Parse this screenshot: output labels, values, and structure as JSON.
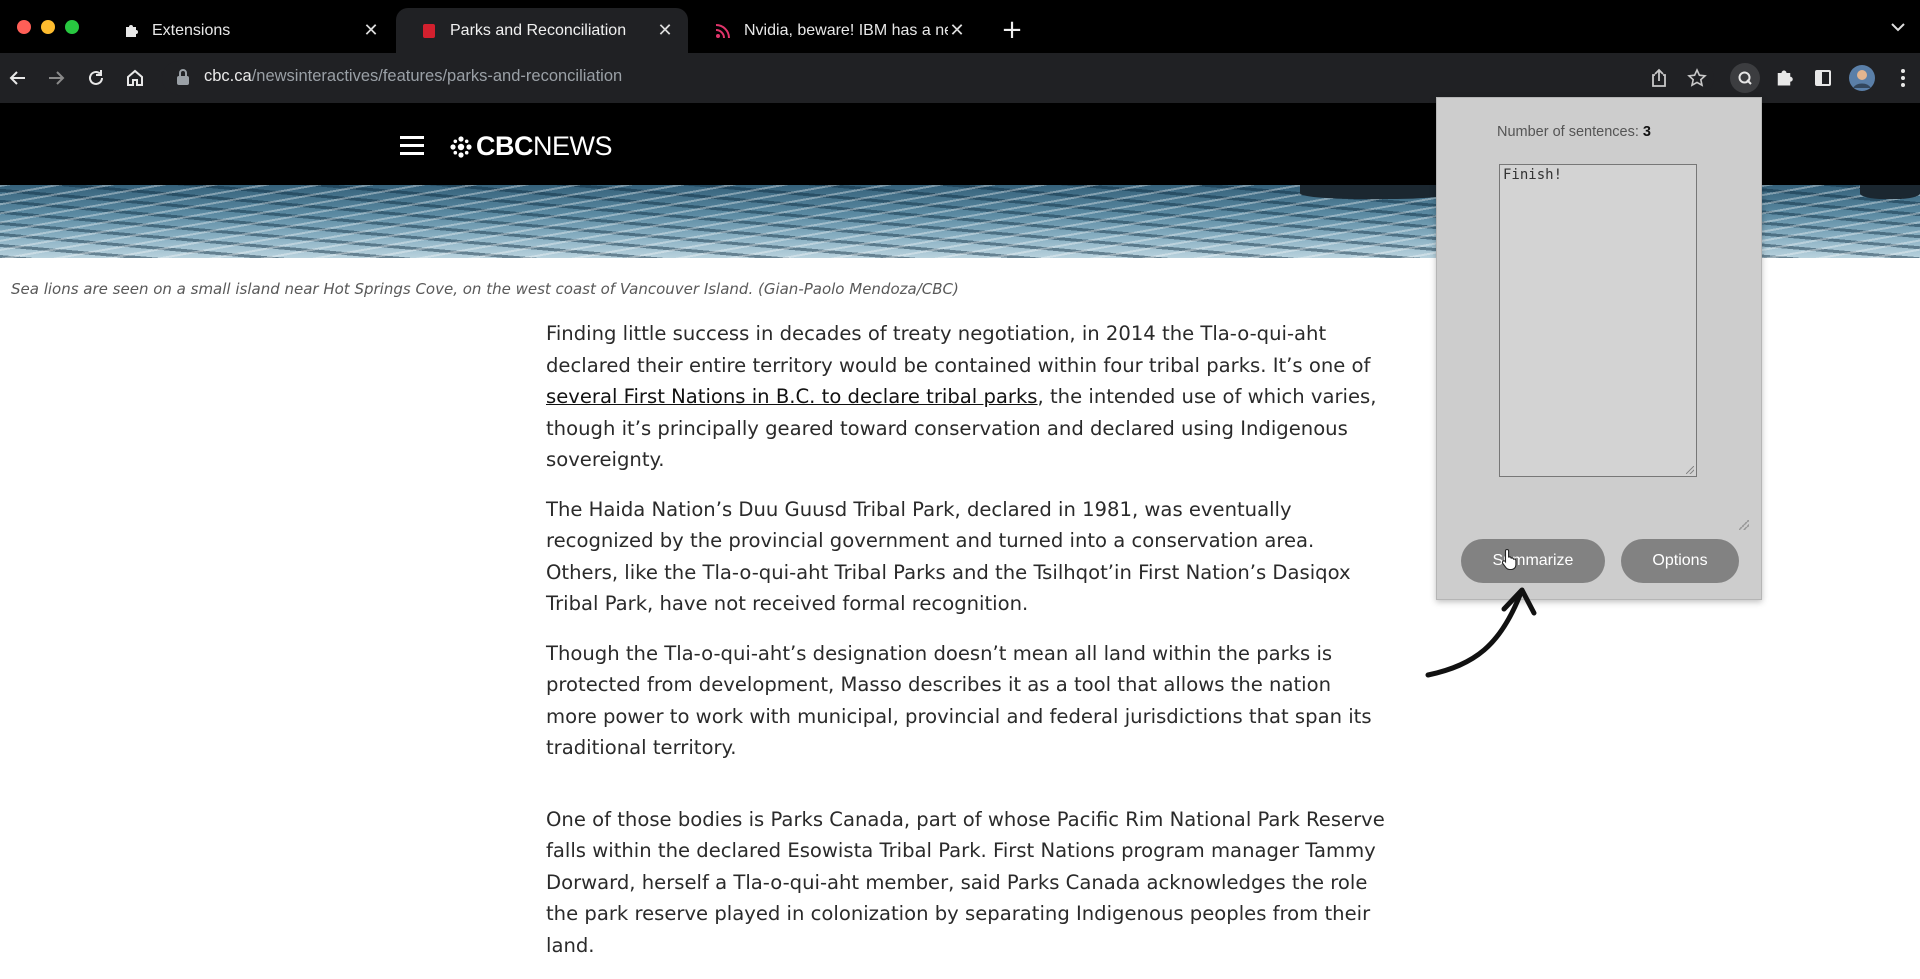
{
  "tabs": [
    {
      "title": "Extensions",
      "icon": "puzzle-icon",
      "active": false
    },
    {
      "title": "Parks and Reconciliation",
      "icon": "cbc-favicon-icon",
      "active": true
    },
    {
      "title": "Nvidia, beware! IBM has a new",
      "icon": "rss-feed-icon",
      "active": false
    }
  ],
  "address_bar": {
    "domain": "cbc.ca",
    "path": "/newsinteractives/features/parks-and-reconciliation"
  },
  "site": {
    "logo_bold": "CBC",
    "logo_light": "NEWS"
  },
  "caption": "Sea lions are seen on a small island near Hot Springs Cove, on the west coast of Vancouver Island. (Gian-Paolo Mendoza/CBC)",
  "article": {
    "p1_before": "Finding little success in decades of treaty negotiation, in 2014 the Tla-o-qui-aht declared their entire territory would be contained within four tribal parks. It’s one of ",
    "p1_link": "several First Nations in B.C. to declare tribal parks",
    "p1_after": ", the intended use of which varies, though it’s principally geared toward conservation and declared using Indigenous sovereignty.",
    "p2": "The Haida Nation’s Duu Guusd Tribal Park, declared in 1981, was eventually recognized by the provincial government and turned into a conservation area. Others, like the Tla-o-qui-aht Tribal Parks and the Tsilhqot’in First Nation’s Dasiqox Tribal Park, have not received formal recognition.",
    "p3": "Though the Tla-o-qui-aht’s designation doesn’t mean all land within the parks is protected from development, Masso describes it as a tool that allows the nation more power to work with municipal, provincial and federal jurisdictions that span its traditional territory.",
    "p4": "One of those bodies is Parks Canada, part of whose Pacific Rim National Park Reserve falls within the declared Esowista Tribal Park. First Nations program manager Tammy Dorward, herself a Tla-o-qui-aht member, said Parks Canada acknowledges the role the park reserve played in colonization by separating Indigenous peoples from their land."
  },
  "popup": {
    "sentences_label": "Number of sentences:",
    "sentences_value": "3",
    "output_text": "Finish!",
    "summarize_label": "Summarize",
    "options_label": "Options"
  },
  "colors": {
    "chrome_bg": "#000000",
    "toolbar_bg": "#202124",
    "popup_bg": "#cdcdcd",
    "button_bg": "#828282"
  }
}
